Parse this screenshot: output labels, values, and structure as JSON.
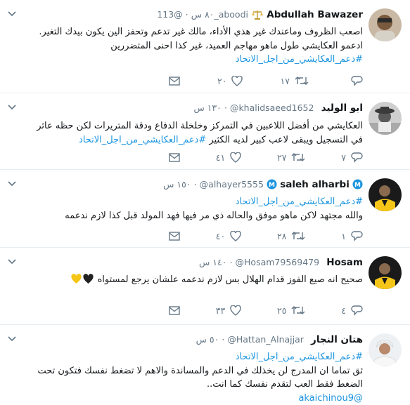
{
  "tweets": [
    {
      "name": "Abdullah Bawazer",
      "handle": "@113_aboodi",
      "time": "٨٠ س",
      "lines": [
        "اصعب الظروف وماعندك غير هذي الأداء، مالك غير تدعم وتحفز الين يكون بيدك التغير.",
        "ادعمو العكايشي طول ماهو مهاجم العميد، غير كذا احنى المتضررين"
      ],
      "hashtag": "#دعم_العكايشي_من_اجل_الاتحاد",
      "replies": "",
      "retweets": "١٧",
      "likes": "٢٠"
    },
    {
      "name": "ابو الوليد",
      "handle": "@khalidsaeed1652",
      "time": "١٣٠ س",
      "lines": [
        "العكايشي من أفضل اللاعبين في التمركز وخلخلة الدفاع ودقة المتريرات لكن حظه عاثر",
        "في التسجيل ويبقى لاعب كبير لديه الكثير"
      ],
      "hashtag": "#دعم_العكايشي_من_اجل_الاتحاد",
      "replies": "٧",
      "retweets": "٢٧",
      "likes": "٤١"
    },
    {
      "name": "saleh alharbi",
      "handle": "@alhayer5555",
      "time": "١٥٠ س",
      "hashtag": "#دعم_العكايشي_من_اجل_الاتحاد",
      "lines": [
        "والله مجتهد لاكن ماهو موفق والحاله ذي مر فيها فهد المولد قبل كذا لازم ندعمه"
      ],
      "replies": "١",
      "retweets": "٢٨",
      "likes": "٤٠"
    },
    {
      "name": "Hosam",
      "handle": "@Hosam79569479",
      "time": "١٤٠ س",
      "lines": [
        "صحيح انه صيع الفوز قدام الهلال بس لازم ندعمه علشان يرجع لمستواه"
      ],
      "replies": "٤",
      "retweets": "٢٥",
      "likes": "٣٣"
    },
    {
      "name": "هتان النجار",
      "handle": "@Hattan_Alnajjar",
      "time": "٥٠ س",
      "hashtag": "#دعم_العكايشي_من_اجل_الاتحاد",
      "lines": [
        "ثق تماما ان المدرج لن يخذلك في الدعم والمساندة والاهم لا تضغط نفسك فتكون تحت",
        "الضغط فقط العب لتقدم نفسك كما انت.."
      ],
      "mention": "@akaichinou9"
    }
  ],
  "icons": {
    "more": "chevron-down-icon",
    "reply": "reply-icon",
    "retweet": "retweet-icon",
    "like": "heart-icon",
    "dm": "envelope-icon",
    "verified": "verified-badge-icon",
    "scale": "scale-emoji-icon",
    "heart_black": "black-heart-emoji",
    "heart_yellow": "yellow-heart-emoji"
  },
  "colors": {
    "link": "#1b95e0",
    "muted": "#657786",
    "divider": "#e6ecf0",
    "ittihad_yellow": "#f5c518"
  }
}
